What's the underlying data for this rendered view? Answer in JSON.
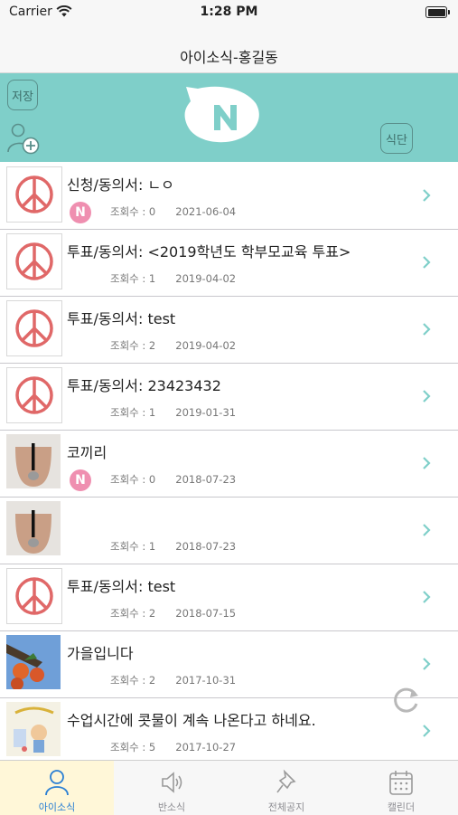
{
  "status_bar": {
    "carrier": "Carrier",
    "time": "1:28 PM"
  },
  "navbar": {
    "title": "아이소식-홍길동"
  },
  "banner": {
    "save_label": "저장",
    "menu_label": "식단",
    "background": "#7fcfc9"
  },
  "rows": [
    {
      "title": "신청/동의서: ㄴㅇ",
      "views": "조회수 : 0",
      "date": "2021-06-04",
      "badge": "N",
      "thumb": "peace"
    },
    {
      "title": "투표/동의서: <2019학년도 학부모교육 투표>",
      "views": "조회수 : 1",
      "date": "2019-04-02",
      "badge": "",
      "thumb": "peace"
    },
    {
      "title": "투표/동의서: test",
      "views": "조회수 : 2",
      "date": "2019-04-02",
      "badge": "",
      "thumb": "peace"
    },
    {
      "title": "투표/동의서: 23423432",
      "views": "조회수 : 1",
      "date": "2019-01-31",
      "badge": "",
      "thumb": "peace"
    },
    {
      "title": "코끼리",
      "views": "조회수 : 0",
      "date": "2018-07-23",
      "badge": "N",
      "thumb": "photo"
    },
    {
      "title": "",
      "views": "조회수 : 1",
      "date": "2018-07-23",
      "badge": "",
      "thumb": "photo"
    },
    {
      "title": "투표/동의서: test",
      "views": "조회수 : 2",
      "date": "2018-07-15",
      "badge": "",
      "thumb": "peace"
    },
    {
      "title": "가을입니다",
      "views": "조회수 : 2",
      "date": "2017-10-31",
      "badge": "",
      "thumb": "persimmon"
    },
    {
      "title": "수업시간에 콧물이 계속 나온다고 하네요.",
      "views": "조회수 : 5",
      "date": "2017-10-27",
      "badge": "",
      "thumb": "drawing"
    }
  ],
  "tabs": [
    {
      "label": "아이소식",
      "icon": "person-icon",
      "active": true
    },
    {
      "label": "반소식",
      "icon": "speaker-icon",
      "active": false
    },
    {
      "label": "전체공지",
      "icon": "pin-icon",
      "active": false
    },
    {
      "label": "캘린더",
      "icon": "calendar-icon",
      "active": false
    }
  ],
  "colors": {
    "accent": "#7fcfc9",
    "badge": "#ef8fb0",
    "chevron": "#7fcfc9",
    "tab_active": "#2a7fd4"
  }
}
